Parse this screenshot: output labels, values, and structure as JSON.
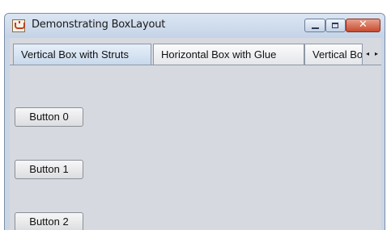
{
  "window": {
    "title": "Demonstrating BoxLayout",
    "controls": {
      "minimize": "minimize",
      "maximize": "maximize",
      "close": "✕"
    }
  },
  "tabs": [
    {
      "label": "Vertical Box with Struts",
      "selected": true
    },
    {
      "label": "Horizontal Box with Glue",
      "selected": false
    },
    {
      "label": "Vertical Box with Glue",
      "selected": false
    }
  ],
  "tab_scroll": {
    "left": "◂",
    "right": "▸"
  },
  "buttons": [
    {
      "label": "Button 0"
    },
    {
      "label": "Button 1"
    },
    {
      "label": "Button 2"
    }
  ],
  "colors": {
    "tab_selected": "#c7d8ec",
    "panel_background": "#d6d9df",
    "close_button": "#c74a2e"
  }
}
